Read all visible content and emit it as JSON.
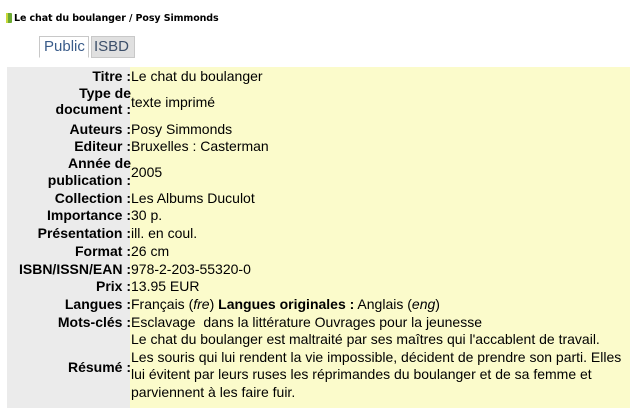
{
  "record": {
    "header_title": "Le chat du boulanger / Posy Simmonds"
  },
  "tabs": {
    "public": "Public",
    "isbd": "ISBD"
  },
  "fields": {
    "titre": {
      "label": "Titre :",
      "value": "Le chat du boulanger"
    },
    "type_l1": "Type de",
    "type_l2": "document :",
    "type_value": "texte imprimé",
    "auteurs": {
      "label": "Auteurs :",
      "value": "Posy Simmonds"
    },
    "editeur": {
      "label": "Editeur :",
      "value": "Bruxelles : Casterman"
    },
    "annee_l1": "Année de",
    "annee_l2": "publication :",
    "annee_value": "2005",
    "collection": {
      "label": "Collection :",
      "value": "Les Albums Duculot"
    },
    "importance": {
      "label": "Importance :",
      "value": "30 p."
    },
    "presentation": {
      "label": "Présentation :",
      "value": "ill. en coul."
    },
    "format": {
      "label": "Format :",
      "value": "26 cm"
    },
    "isbn": {
      "label": "ISBN/ISSN/EAN :",
      "value": "978-2-203-55320-0"
    },
    "prix": {
      "label": "Prix :",
      "value": "13.95 EUR"
    },
    "langues": {
      "label": "Langues :",
      "lang": "Français",
      "lang_code": "fre",
      "orig_label": "Langues originales :",
      "orig_lang": "Anglais",
      "orig_code": "eng"
    },
    "mots_cles": {
      "label": "Mots-clés :",
      "subject_1": "Esclavage  dans la littérature",
      "subject_2": "Ouvrages pour la jeunesse"
    },
    "resume": {
      "label": "Résumé :",
      "value": "Le chat du boulanger est maltraité par ses maîtres qui l'accablent de travail. Les souris qui lui rendent la vie impossible, décident de prendre son parti. Elles lui évitent par leurs ruses les réprimandes du boulanger et de sa femme et parviennent à les faire fuir."
    }
  }
}
